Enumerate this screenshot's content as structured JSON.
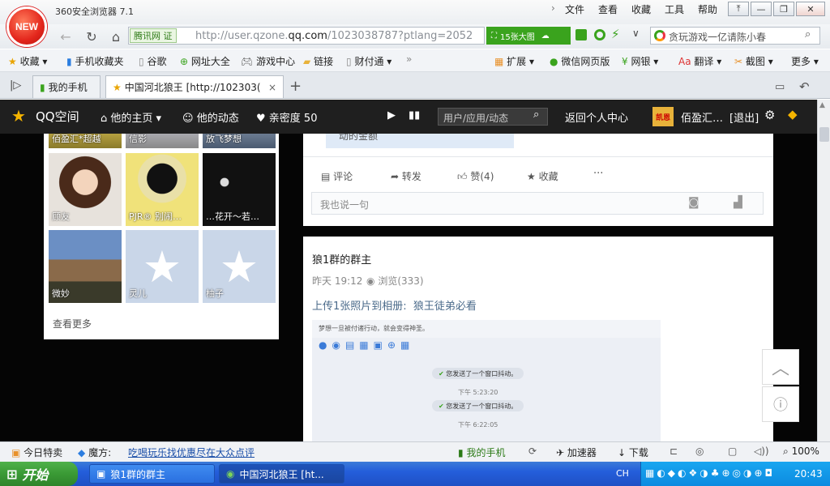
{
  "browser": {
    "logo_text": "NEW",
    "app_title": "360安全浏览器 7.1",
    "menu": [
      "文件",
      "查看",
      "收藏",
      "工具",
      "帮助"
    ],
    "address": {
      "badge": "腾讯网 证",
      "url_prefix": "http://user.qzone.",
      "url_domain": "qq.com",
      "url_rest": "/1023038787?ptlang=2052"
    },
    "green_tool": "15张大图",
    "search_placeholder": "贪玩游戏一亿请陈小春"
  },
  "bookmarks": [
    "收藏",
    "手机收藏夹",
    "谷歌",
    "网址大全",
    "游戏中心",
    "链接",
    "财付通",
    "扩展",
    "微信网页版",
    "网银",
    "翻译",
    "截图",
    "更多"
  ],
  "tabs": [
    {
      "label": "我的手机"
    },
    {
      "label": "中国河北狼王 [http://102303("
    }
  ],
  "qzone": {
    "brand": "QQ空间",
    "nav": [
      "他的主页",
      "他的动态",
      "亲密度 50"
    ],
    "search_placeholder": "用户/应用/动态",
    "back_center": "返回个人中心",
    "user_name": "佰盈汇…",
    "logout": "[退出]",
    "avatar_text": "凯恩"
  },
  "friends": {
    "top_labels": [
      "佰盈汇*超越",
      "信影",
      "放飞梦想"
    ],
    "tiles": [
      "顾友",
      "PJR® 别闹…",
      "…花开～若…",
      "微妙",
      "灵儿",
      "柚子"
    ],
    "see_more": "查看更多"
  },
  "post1": {
    "snippet": "动的金额",
    "actions": [
      "评论",
      "转发",
      "赞(4)",
      "收藏",
      "···"
    ],
    "comment_placeholder": "我也说一句"
  },
  "post2": {
    "author": "狼1群的群主",
    "time": "昨天 19:12",
    "views": "浏览(333)",
    "desc_prefix": "上传1张照片到相册:",
    "album": "狼王徒弟必看",
    "screenshot": {
      "header": "梦想一旦被付诸行动，就会变得神圣。",
      "messages": [
        {
          "text": "您发送了一个窗口抖动。",
          "time": "下午 5:23:20"
        },
        {
          "text": "您发送了一个窗口抖动。",
          "time": "下午 6:22:05"
        }
      ]
    }
  },
  "statusbar": {
    "items": [
      "今日特卖",
      "魔方:",
      "吃喝玩乐找优惠尽在大众点评",
      "我的手机",
      "加速器",
      "下载",
      "100%"
    ]
  },
  "taskbar": {
    "start": "开始",
    "tasks": [
      "狼1群的群主",
      "中国河北狼王 [ht..."
    ],
    "lang": "CH",
    "clock": "20:43"
  }
}
